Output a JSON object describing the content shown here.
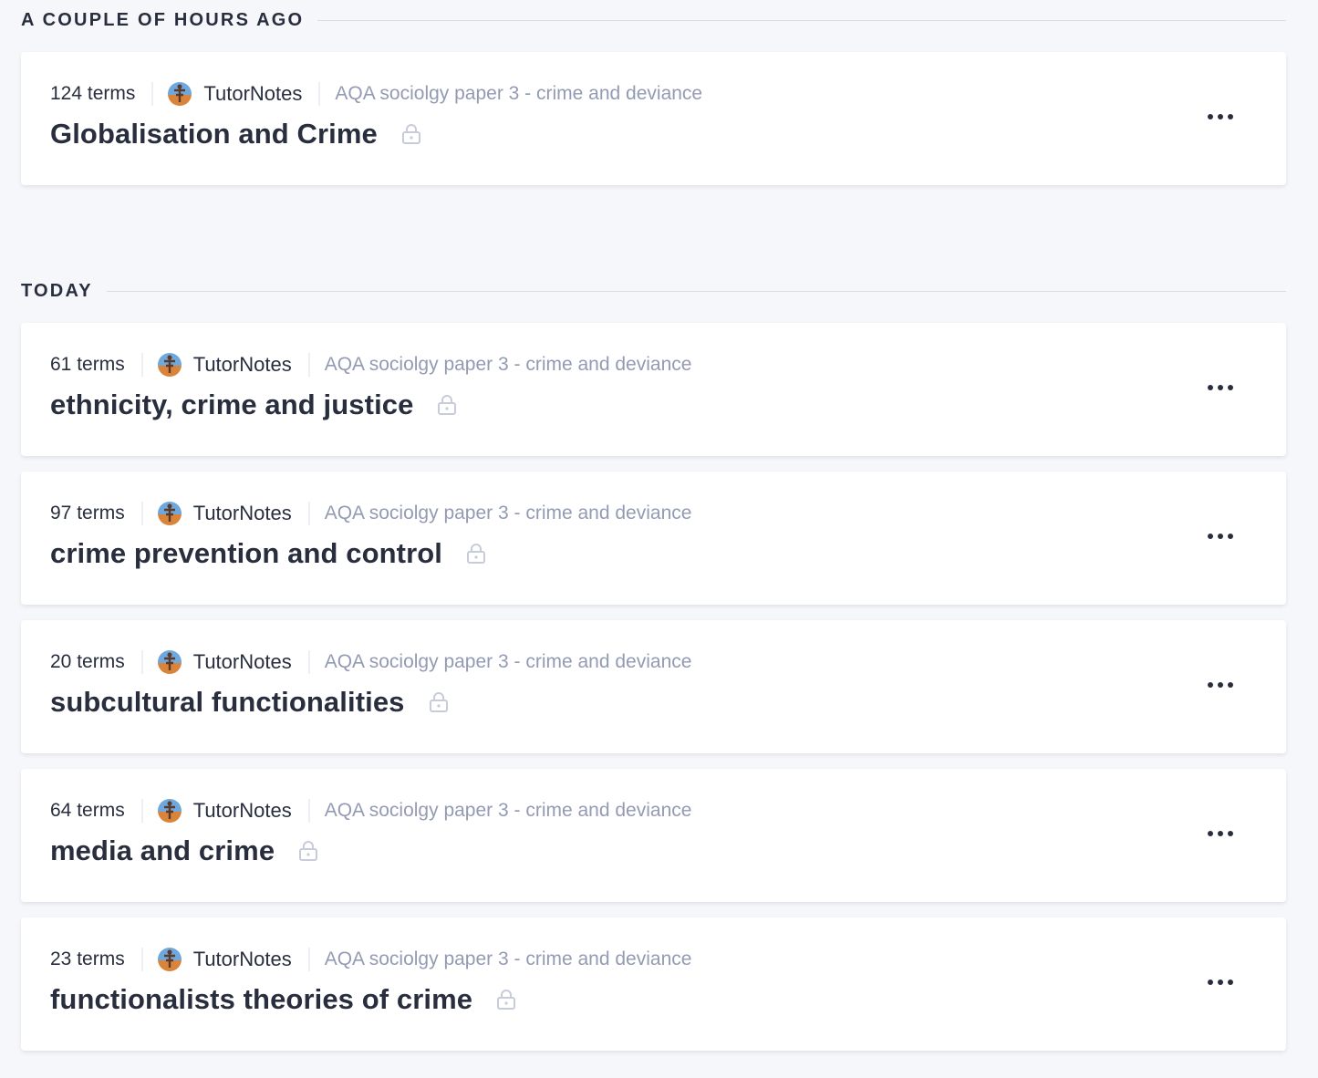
{
  "sections": [
    {
      "label": "A COUPLE OF HOURS AGO",
      "sets": [
        {
          "terms": "124 terms",
          "author": "TutorNotes",
          "folder": "AQA sociolgy paper 3 - crime and deviance",
          "title": "Globalisation and Crime"
        }
      ]
    },
    {
      "label": "TODAY",
      "sets": [
        {
          "terms": "61 terms",
          "author": "TutorNotes",
          "folder": "AQA sociolgy paper 3 - crime and deviance",
          "title": "ethnicity, crime and justice"
        },
        {
          "terms": "97 terms",
          "author": "TutorNotes",
          "folder": "AQA sociolgy paper 3 - crime and deviance",
          "title": "crime prevention and control"
        },
        {
          "terms": "20 terms",
          "author": "TutorNotes",
          "folder": "AQA sociolgy paper 3 - crime and deviance",
          "title": "subcultural functionalities"
        },
        {
          "terms": "64 terms",
          "author": "TutorNotes",
          "folder": "AQA sociolgy paper 3 - crime and deviance",
          "title": "media and crime"
        },
        {
          "terms": "23 terms",
          "author": "TutorNotes",
          "folder": "AQA sociolgy paper 3 - crime and deviance",
          "title": "functionalists theories of crime"
        }
      ]
    }
  ],
  "icons": {
    "lock": "lock-icon",
    "more": "more-options-icon",
    "avatar": "user-avatar"
  },
  "colors": {
    "text_primary": "#282e3e",
    "text_muted": "#939bb4",
    "card_background": "#ffffff",
    "page_background": "#f6f7fb",
    "divider": "#d9dde8"
  }
}
